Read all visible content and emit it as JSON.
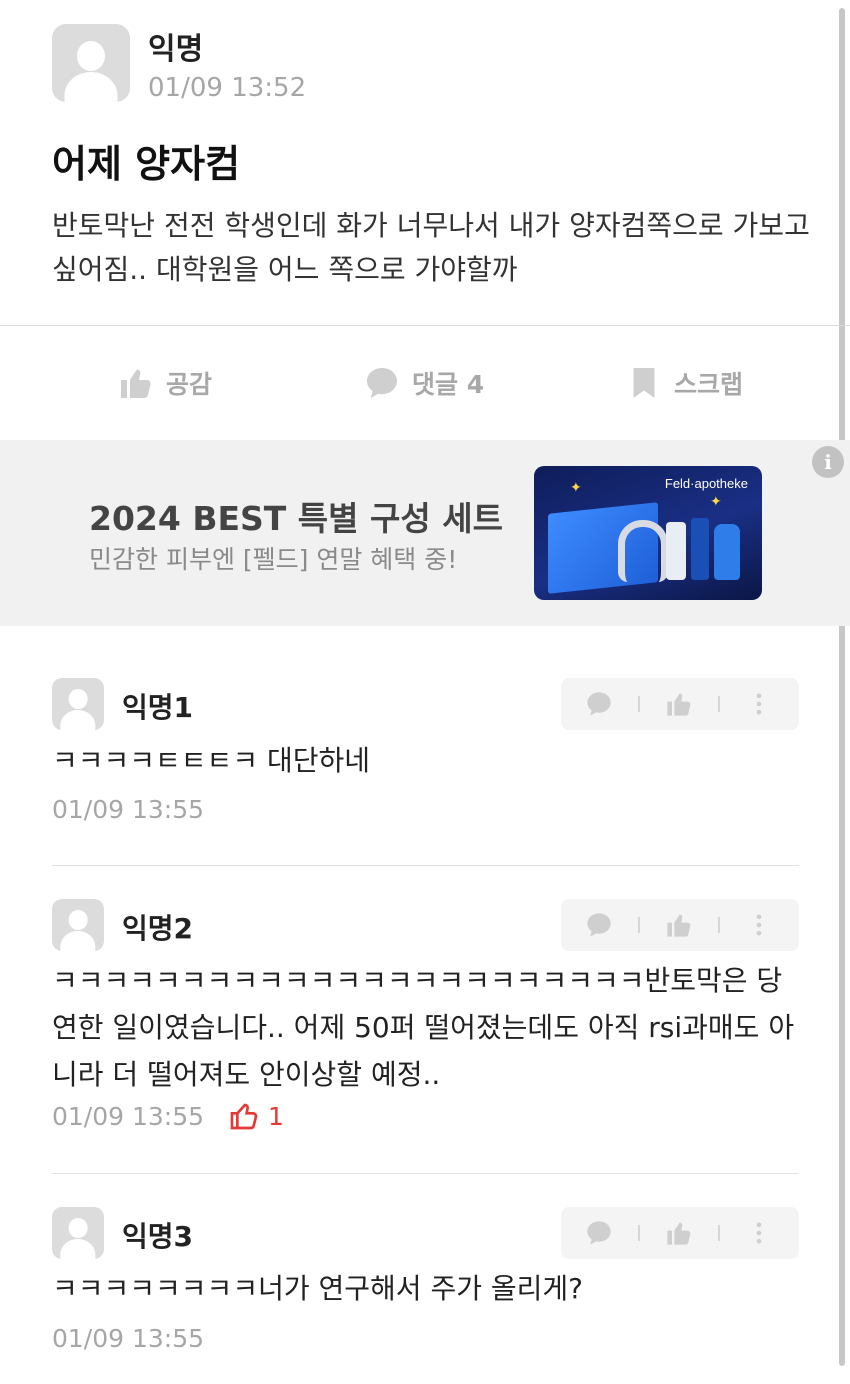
{
  "post": {
    "author": "익명",
    "time": "01/09 13:52",
    "title": "어제 양자컴",
    "body": "반토막난 전전 학생인데 화가 너무나서 내가 양자컴쪽으로 가보고 싶어짐.. 대학원을 어느 쪽으로 가야할까"
  },
  "actions": {
    "like_label": "공감",
    "comment_label": "댓글 4",
    "scrap_label": "스크랩"
  },
  "ad": {
    "title": "2024 BEST 특별 구성 세트",
    "subtitle": "민감한 피부엔 [펠드] 연말 혜택 중!",
    "info_icon": "i",
    "image_brand": "Feld·apotheke"
  },
  "comments": [
    {
      "author": "익명1",
      "text": "ㅋㅋㅋㅋㅌㅌㅌㅋ 대단하네",
      "time": "01/09 13:55",
      "likes": ""
    },
    {
      "author": "익명2",
      "text": "ㅋㅋㅋㅋㅋㅋㅋㅋㅋㅋㅋㅋㅋㅋㅋㅋㅋㅋㅋㅋㅋㅋㅋ반토막은 당연한 일이였습니다.. 어제 50퍼 떨어졌는데도 아직 rsi과매도 아니라 더 떨어져도 안이상할 예정..",
      "time": "01/09 13:55",
      "likes": "1"
    },
    {
      "author": "익명3",
      "text": "ㅋㅋㅋㅋㅋㅋㅋㅋ너가 연구해서 주가 올리게?",
      "time": "01/09 13:55",
      "likes": ""
    }
  ]
}
